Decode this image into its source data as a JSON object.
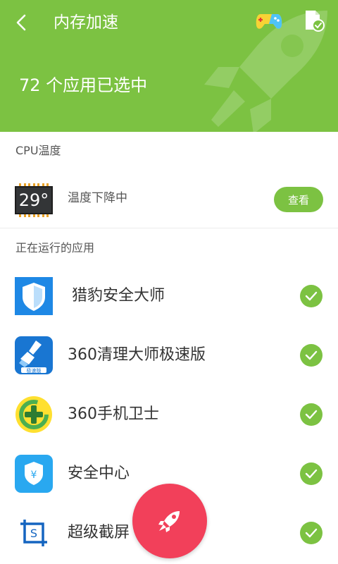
{
  "header": {
    "title": "内存加速",
    "selected_count": "72 个应用已选中",
    "back_icon": "chevron-left-icon",
    "game_icon": "gamepad-icon",
    "clean_icon": "document-check-icon",
    "color": "#7cc242"
  },
  "cpu": {
    "section_label": "CPU温度",
    "temperature": "29°",
    "status": "温度下降中",
    "view_label": "查看"
  },
  "running": {
    "section_label": "正在运行的应用",
    "apps": [
      {
        "name": "猎豹安全大师",
        "icon": "cheetah-security-shield-icon",
        "checked": true
      },
      {
        "name": "360清理大师极速版",
        "icon": "360-cleaner-broom-icon",
        "checked": true
      },
      {
        "name": "360手机卫士",
        "icon": "360-security-plus-icon",
        "checked": true
      },
      {
        "name": "安全中心",
        "icon": "security-center-shield-icon",
        "checked": true
      },
      {
        "name": "超级截屏",
        "icon": "screenshot-crop-icon",
        "checked": true
      }
    ]
  },
  "fab": {
    "icon": "rocket-icon",
    "color": "#f2405a"
  }
}
